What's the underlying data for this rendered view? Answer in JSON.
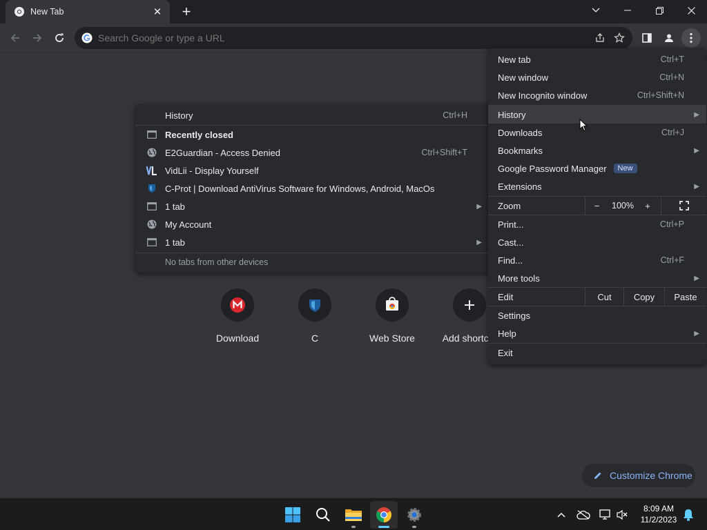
{
  "tab": {
    "title": "New Tab"
  },
  "omnibox": {
    "placeholder": "Search Google or type a URL"
  },
  "shortcuts": [
    {
      "label": "Download"
    },
    {
      "label": "C"
    },
    {
      "label": "Web Store"
    },
    {
      "label": "Add shortcut"
    }
  ],
  "customize": {
    "label": "Customize Chrome"
  },
  "main_menu": {
    "new_tab": {
      "label": "New tab",
      "shortcut": "Ctrl+T"
    },
    "new_window": {
      "label": "New window",
      "shortcut": "Ctrl+N"
    },
    "new_incognito": {
      "label": "New Incognito window",
      "shortcut": "Ctrl+Shift+N"
    },
    "history": {
      "label": "History"
    },
    "downloads": {
      "label": "Downloads",
      "shortcut": "Ctrl+J"
    },
    "bookmarks": {
      "label": "Bookmarks"
    },
    "password_manager": {
      "label": "Google Password Manager",
      "badge": "New"
    },
    "extensions": {
      "label": "Extensions"
    },
    "zoom": {
      "label": "Zoom",
      "minus": "−",
      "value": "100%",
      "plus": "+"
    },
    "print": {
      "label": "Print...",
      "shortcut": "Ctrl+P"
    },
    "cast": {
      "label": "Cast..."
    },
    "find": {
      "label": "Find...",
      "shortcut": "Ctrl+F"
    },
    "more_tools": {
      "label": "More tools"
    },
    "edit": {
      "label": "Edit",
      "cut": "Cut",
      "copy": "Copy",
      "paste": "Paste"
    },
    "settings": {
      "label": "Settings"
    },
    "help": {
      "label": "Help"
    },
    "exit": {
      "label": "Exit"
    }
  },
  "history_menu": {
    "history": {
      "label": "History",
      "shortcut": "Ctrl+H"
    },
    "recently_closed": {
      "label": "Recently closed"
    },
    "items": [
      {
        "label": "E2Guardian - Access Denied",
        "shortcut": "Ctrl+Shift+T",
        "icon": "globe-icon"
      },
      {
        "label": "VidLii - Display Yourself",
        "icon": "vidlii-icon"
      },
      {
        "label": "C-Prot | Download AntiVirus Software for Windows, Android, MacOs",
        "icon": "cprot-icon"
      },
      {
        "label": "1 tab",
        "icon": "window-icon"
      },
      {
        "label": "My Account",
        "icon": "globe-icon"
      },
      {
        "label": "1 tab",
        "icon": "window-icon"
      }
    ],
    "no_devices": {
      "label": "No tabs from other devices"
    }
  },
  "clock": {
    "time": "8:09 AM",
    "date": "11/2/2023"
  },
  "colors": {
    "accent": "#8ab4f8",
    "background": "#35363a",
    "menu": "#292a2d",
    "taskbar_accent": "#60cdff"
  }
}
